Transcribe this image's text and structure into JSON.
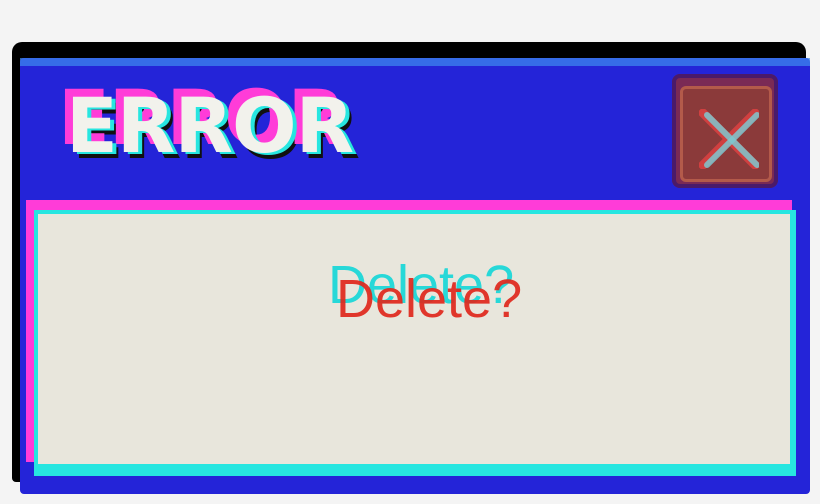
{
  "dialog": {
    "title": "ERROR",
    "message": "Delete?",
    "close_icon": "close-icon"
  },
  "colors": {
    "titlebar": "#2424d8",
    "content_bg": "#e8e6dc",
    "glitch_magenta": "#ff3cd8",
    "glitch_cyan": "#27e6e0",
    "message_red": "#e0281c",
    "close_button": "#8b3a3a"
  }
}
